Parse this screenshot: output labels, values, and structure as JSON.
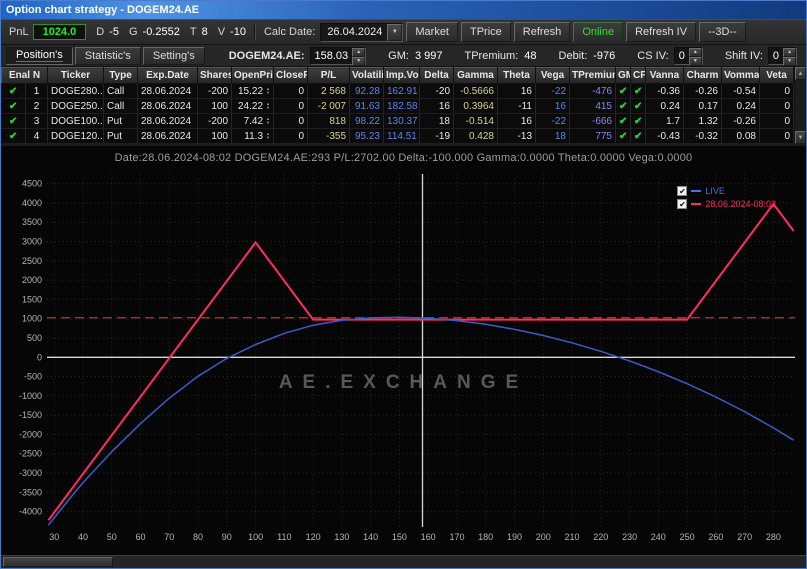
{
  "window": {
    "title": "Option chart strategy - DOGEM24.AE"
  },
  "toolbar": {
    "pnl_label": "PnL",
    "pnl_value": "1024.0",
    "greeks": [
      {
        "label": "D",
        "value": "-5"
      },
      {
        "label": "G",
        "value": "-0.2552"
      },
      {
        "label": "T",
        "value": "8"
      },
      {
        "label": "V",
        "value": "-10"
      }
    ],
    "calc_date_label": "Calc Date:",
    "calc_date_value": "26.04.2024",
    "market": "Market",
    "tprice": "TPrice",
    "refresh": "Refresh",
    "online": "Online",
    "refresh_iv": "Refresh IV",
    "three_d": "--3D--"
  },
  "tabs": [
    {
      "label": "Position's",
      "active": true
    },
    {
      "label": "Statistic's",
      "active": false
    },
    {
      "label": "Setting's",
      "active": false
    }
  ],
  "status": {
    "symbol_label": "DOGEM24.AE:",
    "symbol_value": "158.03",
    "gm_label": "GM:",
    "gm_value": "3 997",
    "tpremium_label": "TPremium:",
    "tpremium_value": "48",
    "debit_label": "Debit:",
    "debit_value": "-976",
    "cs_iv_label": "CS IV:",
    "cs_iv_value": "0",
    "shift_iv_label": "Shift IV:",
    "shift_iv_value": "0"
  },
  "table": {
    "columns": [
      "Enal N",
      "Ticker",
      "Type",
      "Exp.Date",
      "Shares",
      "OpenPric",
      "ClosePri",
      "P/L",
      "Volatili",
      "Imp.Vo",
      "Delta",
      "Gamma",
      "Theta",
      "Vega",
      "TPremium",
      "GM",
      "CPos",
      "Vanna",
      "Charm",
      "Vomma",
      "Veta"
    ],
    "rows": [
      {
        "enabled": true,
        "n": "1",
        "ticker": "DOGE280...",
        "type": "Call",
        "exp_date": "28.06.2024",
        "shares": "-200",
        "open_price": "15.22",
        "close_price": "0",
        "pl": "2 568",
        "volatility": "92.28",
        "imp_vol": "162.91",
        "delta": "-20",
        "gamma": "-0.5666",
        "theta": "16",
        "vega": "-22",
        "tpremium": "-476",
        "gm": true,
        "cpos": true,
        "vanna": "-0.36",
        "charm": "-0.26",
        "vomma": "-0.54",
        "veta": "0"
      },
      {
        "enabled": true,
        "n": "2",
        "ticker": "DOGE250...",
        "type": "Call",
        "exp_date": "28.06.2024",
        "shares": "100",
        "open_price": "24.22",
        "close_price": "0",
        "pl": "-2 007",
        "volatility": "91.63",
        "imp_vol": "182.58",
        "delta": "16",
        "gamma": "0.3964",
        "theta": "-11",
        "vega": "16",
        "tpremium": "415",
        "gm": true,
        "cpos": true,
        "vanna": "0.24",
        "charm": "0.17",
        "vomma": "0.24",
        "veta": "0"
      },
      {
        "enabled": true,
        "n": "3",
        "ticker": "DOGE100...",
        "type": "Put",
        "exp_date": "28.06.2024",
        "shares": "-200",
        "open_price": "7.42",
        "close_price": "0",
        "pl": "818",
        "volatility": "98.22",
        "imp_vol": "130.37",
        "delta": "18",
        "gamma": "-0.514",
        "theta": "16",
        "vega": "-22",
        "tpremium": "-666",
        "gm": true,
        "cpos": true,
        "vanna": "1.7",
        "charm": "1.32",
        "vomma": "-0.26",
        "veta": "0"
      },
      {
        "enabled": true,
        "n": "4",
        "ticker": "DOGE120...",
        "type": "Put",
        "exp_date": "28.06.2024",
        "shares": "100",
        "open_price": "11.3",
        "close_price": "0",
        "pl": "-355",
        "volatility": "95.23",
        "imp_vol": "114.51",
        "delta": "-19",
        "gamma": "0.428",
        "theta": "-13",
        "vega": "18",
        "tpremium": "775",
        "gm": true,
        "cpos": true,
        "vanna": "-0.43",
        "charm": "-0.32",
        "vomma": "0.08",
        "veta": "0"
      }
    ]
  },
  "chart_data": {
    "type": "line",
    "info_line": "Date:28.06.2024-08:02   DOGEM24.AE:293   P/L:2702.00   Delta:-100.000   Gamma:0.0000   Theta:0.0000   Vega:0.0000",
    "watermark": "AE.EXCHANGE",
    "xlim": [
      27.5,
      287.5
    ],
    "ylim": [
      -4400,
      4750
    ],
    "xticks": [
      30,
      40,
      50,
      60,
      70,
      80,
      90,
      100,
      110,
      120,
      130,
      140,
      150,
      160,
      170,
      180,
      190,
      200,
      210,
      220,
      230,
      240,
      250,
      260,
      270,
      280
    ],
    "yticks": [
      4500,
      4000,
      3500,
      3000,
      2500,
      2000,
      1500,
      1000,
      500,
      0,
      -500,
      -1000,
      -1500,
      -2000,
      -2500,
      -3000,
      -3500,
      -4000
    ],
    "current_price_line_x": 158.03,
    "reference_line_y": 1024,
    "zero_line_y": 0,
    "grid": true,
    "legend_position": "top-right",
    "legend": [
      {
        "label": "LIVE",
        "color": "#4a6ce8"
      },
      {
        "label": "28.06.2024-08:02",
        "color": "#ff2d60"
      }
    ],
    "series": [
      {
        "name": "expiration-pl",
        "color": "#ff2d60",
        "width": 2,
        "points": [
          [
            28,
            -4224
          ],
          [
            100,
            2976
          ],
          [
            120,
            976
          ],
          [
            250,
            976
          ],
          [
            280,
            3976
          ],
          [
            287,
            3276
          ]
        ]
      },
      {
        "name": "live-pl",
        "color": "#3c5ccc",
        "width": 1.5,
        "points": [
          [
            28,
            -4350
          ],
          [
            35,
            -3700
          ],
          [
            40,
            -3250
          ],
          [
            50,
            -2450
          ],
          [
            60,
            -1720
          ],
          [
            70,
            -1060
          ],
          [
            80,
            -490
          ],
          [
            90,
            -30
          ],
          [
            100,
            330
          ],
          [
            110,
            620
          ],
          [
            120,
            830
          ],
          [
            130,
            960
          ],
          [
            140,
            1020
          ],
          [
            150,
            1035
          ],
          [
            160,
            1010
          ],
          [
            170,
            950
          ],
          [
            180,
            855
          ],
          [
            190,
            725
          ],
          [
            200,
            565
          ],
          [
            210,
            375
          ],
          [
            220,
            155
          ],
          [
            230,
            -95
          ],
          [
            240,
            -375
          ],
          [
            250,
            -685
          ],
          [
            260,
            -1030
          ],
          [
            270,
            -1410
          ],
          [
            280,
            -1830
          ],
          [
            287,
            -2150
          ]
        ]
      }
    ]
  }
}
